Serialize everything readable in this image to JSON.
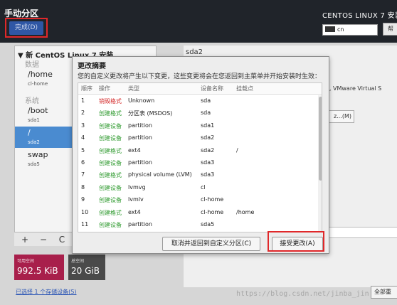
{
  "header": {
    "title": "手动分区",
    "done_label": "完成(D)",
    "product": "CENTOS LINUX 7 安装",
    "keyboard": "cn",
    "help_label": "帮"
  },
  "left_panel": {
    "install_title": "▼ 新 CentOS Linux 7 安装",
    "groups": {
      "data": "数据",
      "system": "系统"
    },
    "mounts": [
      {
        "mount": "/home",
        "device": "cl-home"
      },
      {
        "mount": "/boot",
        "device": "sda1"
      },
      {
        "mount": "/",
        "device": "sda2",
        "selected": true
      },
      {
        "mount": "swap",
        "device": "sda5"
      }
    ],
    "toolbar": {
      "add": "+",
      "remove": "−",
      "refresh": "C"
    }
  },
  "space": {
    "available_caption": "可用空间",
    "available_value": "992.5 KiB",
    "total_caption": "总空间",
    "total_value": "20 GiB"
  },
  "storage_link": "已选择 1 个存储设备(S)",
  "right_panel": {
    "device_label": "sda2",
    "description": "e, VMware Virtual S",
    "modify_label": "z...(M)",
    "reset_label": "全部重"
  },
  "watermark": "https://blog.csdn.net/jinba_jin",
  "dialog": {
    "title": "更改摘要",
    "description": "您的自定义更改将产生以下变更，这些变更将会在您返回到主菜单并开始安装时生效：",
    "columns": [
      "顺序",
      "操作",
      "类型",
      "设备名称",
      "挂载点"
    ],
    "rows": [
      {
        "num": "1",
        "action": "销毁格式",
        "type": "Unknown",
        "device": "sda",
        "mount": "",
        "kind": "destroy"
      },
      {
        "num": "2",
        "action": "创建格式",
        "type": "分区表 (MSDOS)",
        "device": "sda",
        "mount": "",
        "kind": "create"
      },
      {
        "num": "3",
        "action": "创建设备",
        "type": "partition",
        "device": "sda1",
        "mount": "",
        "kind": "create"
      },
      {
        "num": "4",
        "action": "创建设备",
        "type": "partition",
        "device": "sda2",
        "mount": "",
        "kind": "create"
      },
      {
        "num": "5",
        "action": "创建格式",
        "type": "ext4",
        "device": "sda2",
        "mount": "/",
        "kind": "create"
      },
      {
        "num": "6",
        "action": "创建设备",
        "type": "partition",
        "device": "sda3",
        "mount": "",
        "kind": "create"
      },
      {
        "num": "7",
        "action": "创建格式",
        "type": "physical volume (LVM)",
        "device": "sda3",
        "mount": "",
        "kind": "create"
      },
      {
        "num": "8",
        "action": "创建设备",
        "type": "lvmvg",
        "device": "cl",
        "mount": "",
        "kind": "create"
      },
      {
        "num": "9",
        "action": "创建设备",
        "type": "lvmlv",
        "device": "cl-home",
        "mount": "",
        "kind": "create"
      },
      {
        "num": "10",
        "action": "创建格式",
        "type": "ext4",
        "device": "cl-home",
        "mount": "/home",
        "kind": "create"
      },
      {
        "num": "11",
        "action": "创建设备",
        "type": "partition",
        "device": "sda5",
        "mount": "",
        "kind": "create"
      }
    ],
    "cancel_label": "取消并返回到自定义分区(C)",
    "accept_label": "接受更改(A)"
  },
  "colors": {
    "destroy": "#d42b2b",
    "create": "#2e9a2e",
    "highlight": "#e0282a",
    "selection": "#4a8bd0"
  }
}
